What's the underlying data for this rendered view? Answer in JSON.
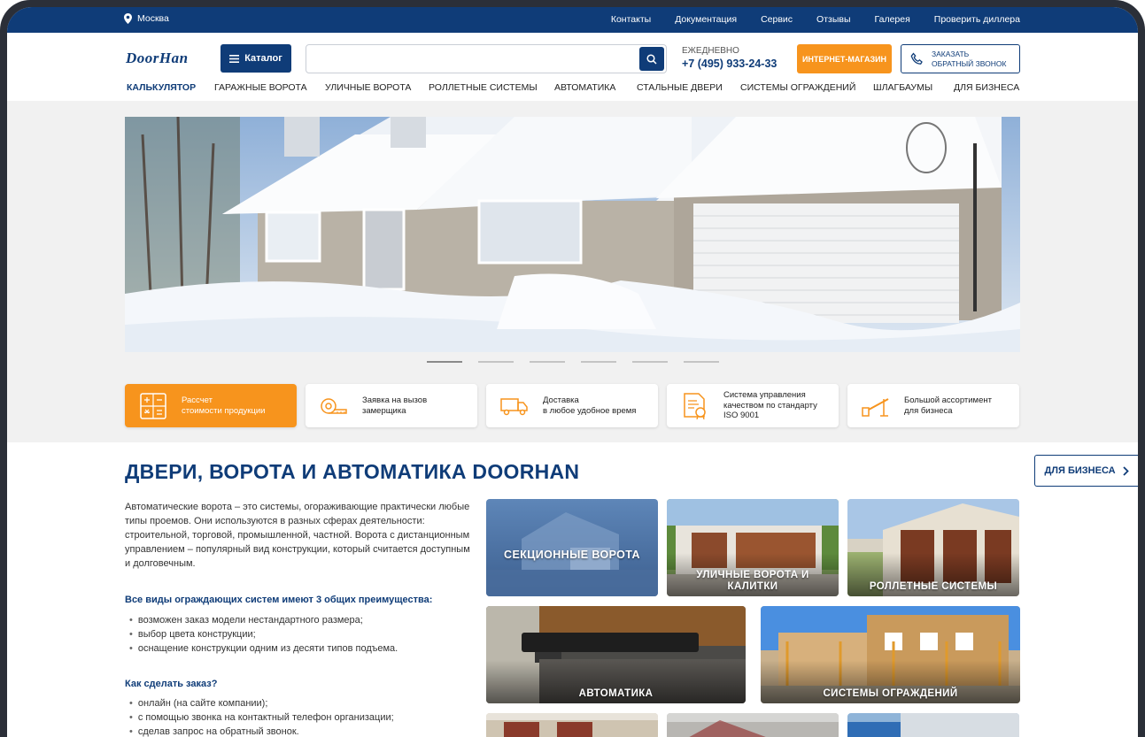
{
  "topbar": {
    "city": "Москва",
    "links": [
      "Контакты",
      "Документация",
      "Сервис",
      "Отзывы",
      "Галерея",
      "Проверить диллера"
    ]
  },
  "header": {
    "logo": "DoorHan",
    "catalog_label": "Каталог",
    "search_placeholder": "",
    "phone_caption": "ЕЖЕДНЕВНО",
    "phone_number": "+7 (495) 933-24-33",
    "shop_label": "ИНТЕРНЕТ-МАГАЗИН",
    "callback_line1": "ЗАКАЗАТЬ",
    "callback_line2": "ОБРАТНЫЙ ЗВОНОК"
  },
  "nav": [
    "КАЛЬКУЛЯТОР",
    "ГАРАЖНЫЕ ВОРОТА",
    "УЛИЧНЫЕ ВОРОТА",
    "РОЛЛЕТНЫЕ СИСТЕМЫ",
    "АВТОМАТИКА",
    "СТАЛЬНЫЕ ДВЕРИ",
    "СИСТЕМЫ ОГРАЖДЕНИЙ",
    "ШЛАГБАУМЫ",
    "ДЛЯ БИЗНЕСА"
  ],
  "slider": {
    "count": 6,
    "active": 0
  },
  "features": [
    {
      "l1": "Рассчет",
      "l2": "стоимости продукции",
      "l3": ""
    },
    {
      "l1": "Заявка на вызов",
      "l2": "замерщика",
      "l3": ""
    },
    {
      "l1": "Доставка",
      "l2": "в любое удобное время",
      "l3": ""
    },
    {
      "l1": "Система управления",
      "l2": "качеством по стандарту",
      "l3": "ISO 9001"
    },
    {
      "l1": "Большой ассортимент",
      "l2": "для бизнеса",
      "l3": ""
    }
  ],
  "main": {
    "title": "ДВЕРИ, ВОРОТА И АВТОМАТИКА DOORHAN",
    "business_button": "ДЛЯ БИЗНЕСА",
    "intro": "Автоматические ворота – это системы, огораживающие практически любые типы проемов. Они используются в разных сферах деятельности: строительной, торговой, промышленной, частной. Ворота с дистанционным управлением – популярный вид конструкции, который считается доступным и долговечным.",
    "advantages_title": "Все виды ограждающих систем имеют 3 общих преимущества:",
    "advantages": [
      "возможен заказ модели нестандартного размера;",
      "выбор цвета конструкции;",
      "оснащение конструкции одним из десяти типов подъема."
    ],
    "order_title": "Как сделать заказ?",
    "order_ways": [
      "онлайн (на сайте компании);",
      "с помощью звонка на контактный телефон организации;",
      "сделав запрос на обратный звонок."
    ]
  },
  "tiles": [
    "СЕКЦИОННЫЕ ВОРОТА",
    "УЛИЧНЫЕ ВОРОТА И КАЛИТКИ",
    "РОЛЛЕТНЫЕ СИСТЕМЫ",
    "АВТОМАТИКА",
    "СИСТЕМЫ ОГРАЖДЕНИЙ"
  ],
  "colors": {
    "brand": "#0f3c78",
    "accent": "#f7941d"
  }
}
